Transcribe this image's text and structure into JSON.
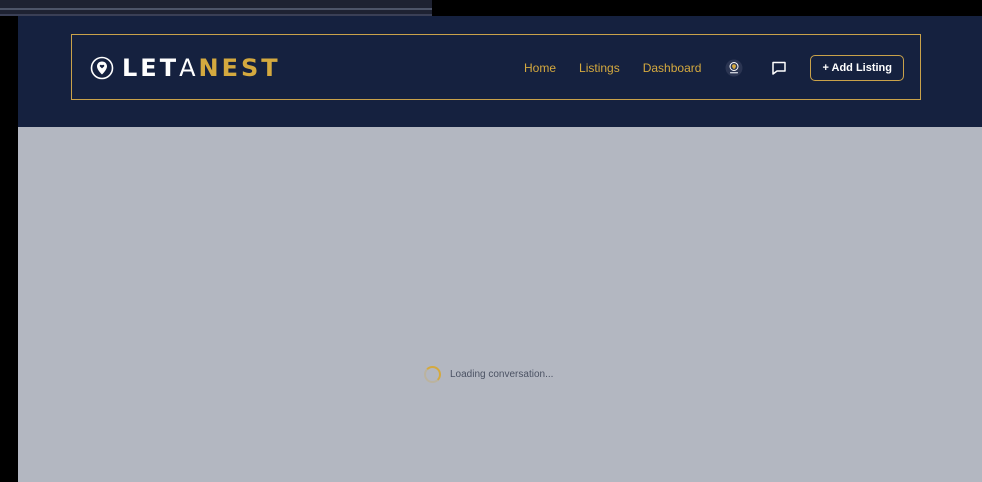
{
  "header": {
    "logo": {
      "part_let": "LET",
      "part_a": "A",
      "part_nest": "NEST",
      "icon": "map-pin-heart-icon"
    },
    "nav": {
      "home": "Home",
      "listings": "Listings",
      "dashboard": "Dashboard",
      "avatar_icon": "nest-avatar-icon",
      "chat_icon": "chat-bubble-icon",
      "add_listing": "+ Add Listing"
    }
  },
  "main": {
    "loading_text": "Loading conversation..."
  },
  "colors": {
    "header_bg": "#15213f",
    "accent_gold": "#d4a93f",
    "content_bg": "#b3b7c1"
  }
}
